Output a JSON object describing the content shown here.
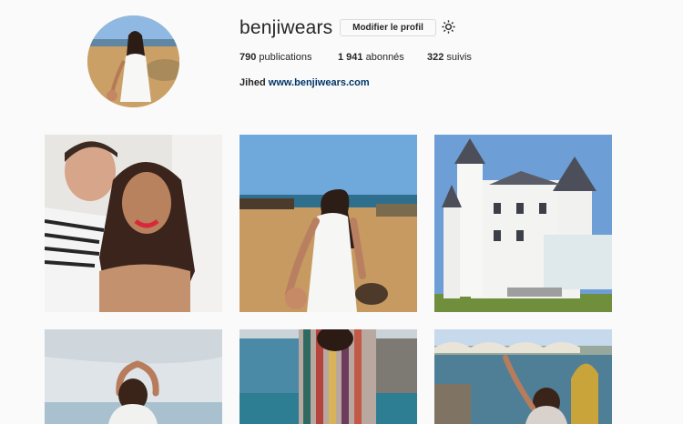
{
  "profile": {
    "username": "benjiwears",
    "edit_button": "Modifier le profil",
    "settings_icon": "gear-icon",
    "stats": {
      "posts_count": "790",
      "posts_label": "publications",
      "followers_count": "1 941",
      "followers_label": "abonnés",
      "following_count": "322",
      "following_label": "suivis"
    },
    "bio_name": "Jihed",
    "bio_link": "www.benjiwears.com"
  },
  "posts": [
    {
      "subject": "couple selfie"
    },
    {
      "subject": "beach follow-me"
    },
    {
      "subject": "white castle hotel"
    },
    {
      "subject": "heart hands sea"
    },
    {
      "subject": "striped dress terrace"
    },
    {
      "subject": "river bridge wave"
    }
  ]
}
